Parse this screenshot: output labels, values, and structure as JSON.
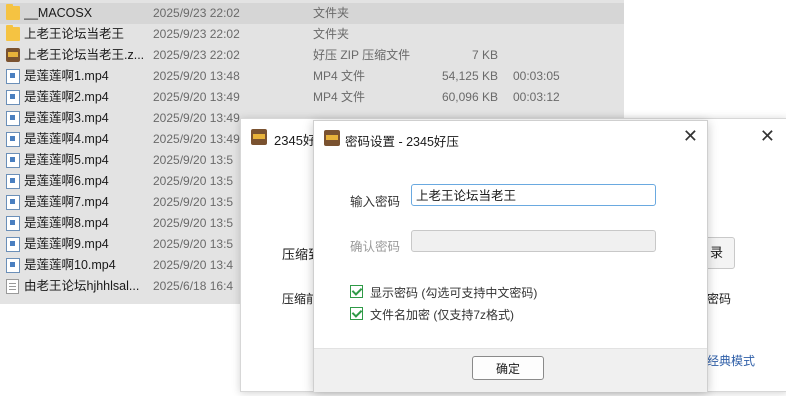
{
  "files": [
    {
      "name": "__MACOSX",
      "date": "2025/9/23 22:02",
      "type": "文件夹",
      "size": "",
      "duration": "",
      "icon": "folder-icon"
    },
    {
      "name": "上老王论坛当老王",
      "date": "2025/9/23 22:02",
      "type": "文件夹",
      "size": "",
      "duration": "",
      "icon": "folder-icon"
    },
    {
      "name": "上老王论坛当老王.z...",
      "date": "2025/9/23 22:02",
      "type": "好压 ZIP 压缩文件",
      "size": "7 KB",
      "duration": "",
      "icon": "zip-archive-icon"
    },
    {
      "name": "是莲莲啊1.mp4",
      "date": "2025/9/20 13:48",
      "type": "MP4 文件",
      "size": "54,125 KB",
      "duration": "00:03:05",
      "icon": "video-file-icon"
    },
    {
      "name": "是莲莲啊2.mp4",
      "date": "2025/9/20 13:49",
      "type": "MP4 文件",
      "size": "60,096 KB",
      "duration": "00:03:12",
      "icon": "video-file-icon"
    },
    {
      "name": "是莲莲啊3.mp4",
      "date": "2025/9/20 13:49",
      "type": "",
      "size": "",
      "duration": "",
      "icon": "video-file-icon"
    },
    {
      "name": "是莲莲啊4.mp4",
      "date": "2025/9/20 13:49",
      "type": "",
      "size": "",
      "duration": "",
      "icon": "video-file-icon"
    },
    {
      "name": "是莲莲啊5.mp4",
      "date": "2025/9/20 13:5",
      "type": "",
      "size": "",
      "duration": "",
      "icon": "video-file-icon"
    },
    {
      "name": "是莲莲啊6.mp4",
      "date": "2025/9/20 13:5",
      "type": "",
      "size": "",
      "duration": "",
      "icon": "video-file-icon"
    },
    {
      "name": "是莲莲啊7.mp4",
      "date": "2025/9/20 13:5",
      "type": "",
      "size": "",
      "duration": "",
      "icon": "video-file-icon"
    },
    {
      "name": "是莲莲啊8.mp4",
      "date": "2025/9/20 13:5",
      "type": "",
      "size": "",
      "duration": "",
      "icon": "video-file-icon"
    },
    {
      "name": "是莲莲啊9.mp4",
      "date": "2025/9/20 13:5",
      "type": "",
      "size": "",
      "duration": "",
      "icon": "video-file-icon"
    },
    {
      "name": "是莲莲啊10.mp4",
      "date": "2025/9/20 13:4",
      "type": "",
      "size": "",
      "duration": "",
      "icon": "video-file-icon"
    },
    {
      "name": "由老王论坛hjhhlsal...",
      "date": "2025/6/18 16:4",
      "type": "",
      "size": "",
      "duration": "",
      "icon": "text-file-icon"
    }
  ],
  "bg_window": {
    "title": "2345好",
    "label_compress": "压缩到",
    "label_compress2": "压缩前",
    "button_fragment": "录",
    "text_fragment": "密码",
    "link_classic": "经典模式"
  },
  "dialog": {
    "title": "密码设置 - 2345好压",
    "password_label": "输入密码",
    "password_value": "上老王论坛当老王",
    "confirm_label": "确认密码",
    "confirm_value": "",
    "show_password_label": "显示密码 (勾选可支持中文密码)",
    "show_password_checked": true,
    "encrypt_names_label": "文件名加密 (仅支持7z格式)",
    "encrypt_names_checked": true,
    "ok_label": "确定",
    "close_glyph": "✕"
  },
  "colors": {
    "list_bg": "#e3e3e3",
    "accent_green": "#2f9a47",
    "input_focus": "#6aa9e0",
    "link_blue": "#2f5fa8"
  }
}
